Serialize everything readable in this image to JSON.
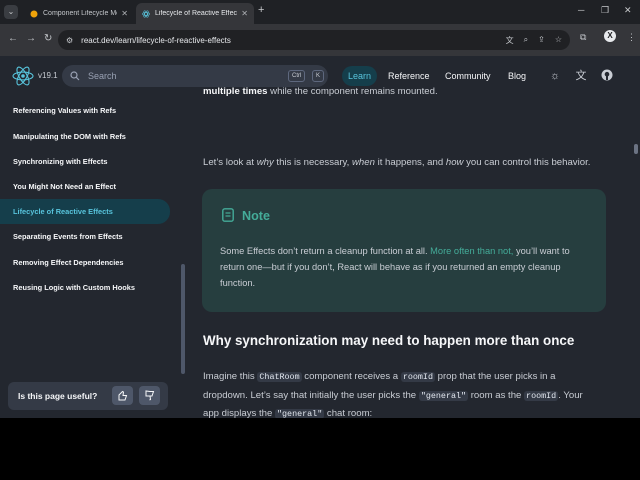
{
  "browser": {
    "tabs": [
      {
        "title": "Component Lifecycle Methods | Th"
      },
      {
        "title": "Lifecycle of Reactive Effects – Reac"
      }
    ],
    "url": "react.dev/learn/lifecycle-of-reactive-effects",
    "profile_initial": "X"
  },
  "header": {
    "version": "v19.1",
    "search_placeholder": "Search",
    "kbd_ctrl": "Ctrl",
    "kbd_k": "K",
    "nav": [
      {
        "label": "Learn"
      },
      {
        "label": "Reference"
      },
      {
        "label": "Community"
      },
      {
        "label": "Blog"
      }
    ]
  },
  "sidebar": {
    "items": [
      {
        "label": "Referencing Values with Refs"
      },
      {
        "label": "Manipulating the DOM with Refs"
      },
      {
        "label": "Synchronizing with Effects"
      },
      {
        "label": "You Might Not Need an Effect"
      },
      {
        "label": "Lifecycle of Reactive Effects"
      },
      {
        "label": "Separating Events from Effects"
      },
      {
        "label": "Removing Effect Dependencies"
      },
      {
        "label": "Reusing Logic with Custom Hooks"
      }
    ],
    "feedback_question": "Is this page useful?"
  },
  "main": {
    "cut_line": {
      "bold": "multiple times",
      "rest": " while the component remains mounted."
    },
    "para1": {
      "a": "Let’s look at ",
      "why": "why",
      "b": " this is necessary, ",
      "when": "when",
      "c": " it happens, and ",
      "how": "how",
      "d": " you can control this behavior."
    },
    "note": {
      "title": "Note",
      "a": "Some Effects don’t return a cleanup function at all. ",
      "link": "More often than not,",
      "b": " you’ll want to return one—but if you don’t, React will behave as if you returned an empty cleanup function."
    },
    "heading": "Why synchronization may need to happen more than once",
    "para2": {
      "a": "Imagine this ",
      "code1": "ChatRoom",
      "b": " component receives a ",
      "code2": "roomId",
      "c": " prop that the user picks in a dropdown. Let’s say that initially the user picks the ",
      "code3": "\"general\"",
      "d": " room as the ",
      "code4": "roomId",
      "e": ". Your app displays the ",
      "code5": "\"general\"",
      "f": " chat room:"
    }
  }
}
